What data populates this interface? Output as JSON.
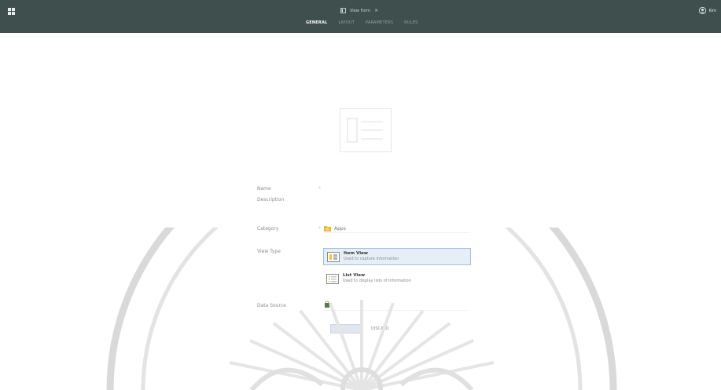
{
  "header": {
    "doc_tab": {
      "title": "View Form",
      "close": "×"
    },
    "user": {
      "name": "Kim"
    }
  },
  "subtabs": [
    {
      "label": "GENERAL",
      "active": true
    },
    {
      "label": "LAYOUT",
      "active": false
    },
    {
      "label": "PARAMETERS",
      "active": false
    },
    {
      "label": "RULES",
      "active": false
    }
  ],
  "form": {
    "name_label": "Name",
    "name_required": "*",
    "description_label": "Description",
    "category_label": "Category",
    "category_required": "*",
    "category_value": "Apps",
    "view_type_label": "View Type",
    "view_types": [
      {
        "title": "Item View",
        "desc": "Used to capture information",
        "selected": true
      },
      {
        "title": "List View",
        "desc": "Used to display lists of information",
        "selected": false
      }
    ],
    "data_source_label": "Data Source",
    "create_label": "",
    "cancel_label": "DISCARD"
  },
  "colors": {
    "header_bg": "#3f4f4e",
    "selected_bg": "#e6eff8",
    "selected_border": "#9fbde0"
  }
}
